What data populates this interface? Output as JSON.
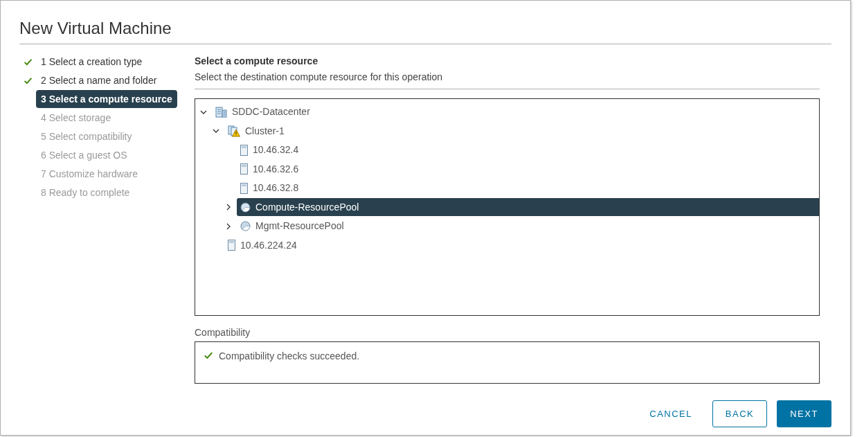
{
  "dialog": {
    "title": "New Virtual Machine"
  },
  "steps": [
    {
      "label": "1 Select a creation type",
      "completed": true,
      "selected": false
    },
    {
      "label": "2 Select a name and folder",
      "completed": true,
      "selected": false
    },
    {
      "label": "3 Select a compute resource",
      "completed": false,
      "selected": true
    },
    {
      "label": "4 Select storage",
      "completed": false,
      "selected": false
    },
    {
      "label": "5 Select compatibility",
      "completed": false,
      "selected": false
    },
    {
      "label": "6 Select a guest OS",
      "completed": false,
      "selected": false
    },
    {
      "label": "7 Customize hardware",
      "completed": false,
      "selected": false
    },
    {
      "label": "8 Ready to complete",
      "completed": false,
      "selected": false
    }
  ],
  "page": {
    "heading": "Select a compute resource",
    "subtitle": "Select the destination compute resource for this operation"
  },
  "tree": [
    {
      "label": "SDDC-Datacenter",
      "kind": "datacenter",
      "expanded": true,
      "selected": false,
      "children": [
        {
          "label": "Cluster-1",
          "kind": "cluster",
          "warning": true,
          "expanded": true,
          "selected": false,
          "children": [
            {
              "label": "10.46.32.4",
              "kind": "host",
              "selected": false
            },
            {
              "label": "10.46.32.6",
              "kind": "host",
              "selected": false
            },
            {
              "label": "10.46.32.8",
              "kind": "host",
              "selected": false
            },
            {
              "label": "Compute-ResourcePool",
              "kind": "pool",
              "expanded": false,
              "selected": true
            },
            {
              "label": "Mgmt-ResourcePool",
              "kind": "pool",
              "expanded": false,
              "selected": false
            }
          ]
        },
        {
          "label": "10.46.224.24",
          "kind": "host",
          "selected": false
        }
      ]
    }
  ],
  "compatibility": {
    "label": "Compatibility",
    "message": "Compatibility checks succeeded."
  },
  "buttons": [
    {
      "label": "CANCEL",
      "kind": "link"
    },
    {
      "label": "BACK",
      "kind": "outline"
    },
    {
      "label": "NEXT",
      "kind": "primary"
    }
  ]
}
